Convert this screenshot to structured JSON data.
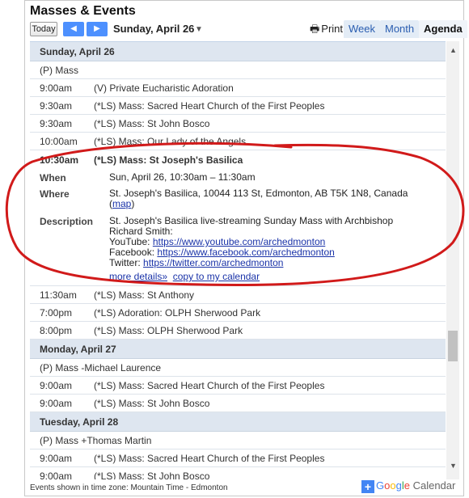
{
  "header": {
    "title": "Masses & Events",
    "today_label": "Today",
    "prev_icon": "◀",
    "next_icon": "▶",
    "current_date": "Sunday, April 26",
    "dropdown_icon": "▼",
    "print_label": "Print",
    "tabs": {
      "week": "Week",
      "month": "Month",
      "agenda": "Agenda"
    }
  },
  "days": {
    "sun": {
      "label": "Sunday, April 26",
      "allday": "(P) Mass",
      "events": [
        {
          "time": "9:00am",
          "title": "(V) Private Eucharistic Adoration"
        },
        {
          "time": "9:30am",
          "title": "(*LS) Mass: Sacred Heart Church of the First Peoples"
        },
        {
          "time": "9:30am",
          "title": "(*LS) Mass: St John Bosco"
        },
        {
          "time": "10:00am",
          "title": "(*LS) Mass: Our Lady of the Angels"
        }
      ],
      "expanded": {
        "time": "10:30am",
        "title": "(*LS) Mass: St Joseph's Basilica",
        "when_label": "When",
        "when_value": "Sun, April 26, 10:30am – 11:30am",
        "where_label": "Where",
        "where_value": "St. Joseph's Basilica, 10044 113 St, Edmonton, AB T5K 1N8, Canada",
        "map_link": "map",
        "description_label": "Description",
        "description_line1": "St. Joseph's Basilica  live-streaming Sunday Mass with Archbishop",
        "description_line2": "Richard Smith:",
        "youtube_label": "YouTube:",
        "youtube_url": "https://www.youtube.com/archedmonton",
        "facebook_label": "Facebook:",
        "facebook_url": "https://www.facebook.com/archedmonton",
        "twitter_label": "Twitter:",
        "twitter_url": "https://twitter.com/archedmonton",
        "more_details": "more details»",
        "copy_calendar": "copy to my calendar"
      },
      "later_events": [
        {
          "time": "11:30am",
          "title": "(*LS) Mass: St Anthony"
        },
        {
          "time": "7:00pm",
          "title": "(*LS) Adoration: OLPH Sherwood Park"
        },
        {
          "time": "8:00pm",
          "title": "(*LS) Mass: OLPH Sherwood Park"
        }
      ]
    },
    "mon": {
      "label": "Monday, April 27",
      "allday": "(P) Mass -Michael Laurence",
      "events": [
        {
          "time": "9:00am",
          "title": "(*LS) Mass: Sacred Heart Church of the First Peoples"
        },
        {
          "time": "9:00am",
          "title": "(*LS) Mass: St John Bosco"
        }
      ]
    },
    "tue": {
      "label": "Tuesday, April 28",
      "allday": "(P) Mass +Thomas Martin",
      "events": [
        {
          "time": "9:00am",
          "title": "(*LS) Mass: Sacred Heart Church of the First Peoples"
        },
        {
          "time": "9:00am",
          "title": "(*LS) Mass: St John Bosco"
        }
      ]
    }
  },
  "footer": {
    "timezone_note": "Events shown in time zone: Mountain Time - Edmonton",
    "badge_plus": "+",
    "badge_google": "Google",
    "badge_calendar": "Calendar"
  },
  "scrollbar": {
    "up_icon": "▲",
    "down_icon": "▼"
  },
  "colors": {
    "accent": "#4d90fe",
    "link": "#1a33a8",
    "day_header_bg": "#dee6f0",
    "annotation": "#d11a1a"
  }
}
